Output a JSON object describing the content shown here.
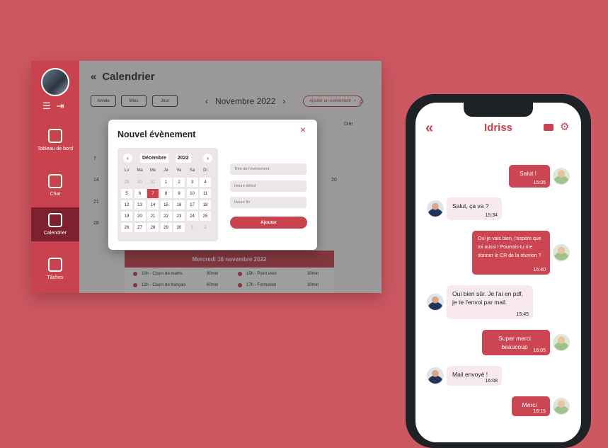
{
  "colors": {
    "background": "#cc5862",
    "accent": "#c9434f",
    "active_nav": "#7d2030"
  },
  "desktop": {
    "nav": [
      {
        "label": "Tableau de bord",
        "icon": "home-icon"
      },
      {
        "label": "Chat",
        "icon": "chat-icon"
      },
      {
        "label": "Calendrier",
        "icon": "calendar-icon",
        "active": true
      },
      {
        "label": "Tâches",
        "icon": "tasks-icon"
      }
    ],
    "title": "Calendrier",
    "views": [
      "Année",
      "Mois",
      "Jour"
    ],
    "month": "Novembre 2022",
    "add_event": "Ajouter un évènement",
    "day_header": "Dim",
    "grid_numbers": [
      "7",
      "14",
      "21",
      "28",
      "20"
    ],
    "events_panel": {
      "title": "Mercredi 16 novembre 2022",
      "events": [
        {
          "label": "10h - Cours de maths",
          "duration": "90min"
        },
        {
          "label": "15h - Point visio",
          "duration": "30min"
        },
        {
          "label": "12h - Cours de français",
          "duration": "60min"
        },
        {
          "label": "17h - Formation",
          "duration": "30min"
        }
      ]
    }
  },
  "modal": {
    "title": "Nouvel évènement",
    "close": "×",
    "month_select": "Décembre",
    "year_select": "2022",
    "weekdays": [
      "Lu",
      "Ma",
      "Me",
      "Je",
      "Ve",
      "Sa",
      "Di"
    ],
    "days": [
      [
        "29",
        "30",
        "31",
        "1",
        "2",
        "3",
        "4"
      ],
      [
        "5",
        "6",
        "7",
        "8",
        "9",
        "10",
        "11"
      ],
      [
        "12",
        "13",
        "14",
        "15",
        "16",
        "17",
        "18"
      ],
      [
        "19",
        "20",
        "21",
        "22",
        "23",
        "24",
        "25"
      ],
      [
        "26",
        "27",
        "28",
        "29",
        "30",
        "1",
        "2"
      ]
    ],
    "selected_day": "7",
    "fields": {
      "title_placeholder": "Titre de l'évènement",
      "start_placeholder": "Heure début",
      "end_placeholder": "Heure fin"
    },
    "submit": "Ajouter"
  },
  "phone": {
    "contact": "Idriss",
    "messages": [
      {
        "dir": "out",
        "text": "Salut !",
        "time": "15:05"
      },
      {
        "dir": "in",
        "text": "Salut, ça va ?",
        "time": "15:34"
      },
      {
        "dir": "out",
        "text": "Oui je vais bien, j'espère que toi aussi ! Pourrais-tu me donner le CR de la réunion ?",
        "time": "15:40"
      },
      {
        "dir": "in",
        "text": "Oui bien sûr. Je l'ai en pdf, je te l'envoi par mail.",
        "time": "15:45"
      },
      {
        "dir": "out",
        "text": "Super merci beaucoup",
        "time": "16:05"
      },
      {
        "dir": "in",
        "text": "Mail envoyé !",
        "time": "16:08"
      },
      {
        "dir": "out",
        "text": "Merci",
        "time": "16:15"
      }
    ]
  }
}
